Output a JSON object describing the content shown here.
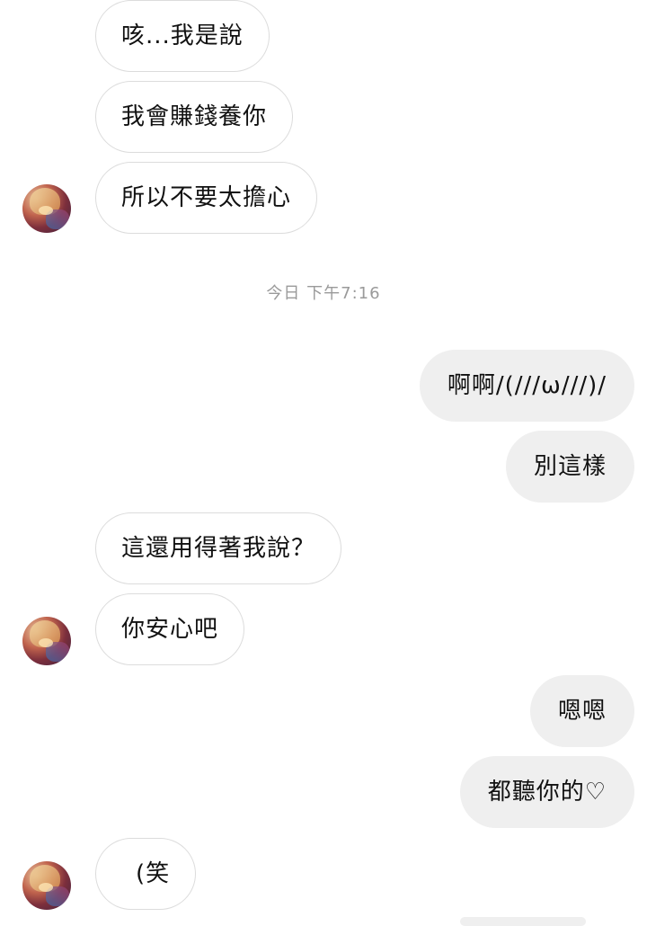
{
  "conversation": {
    "timestamp": "今日 下午7:16",
    "messages": [
      {
        "sender": "them",
        "text": "咳...我是說"
      },
      {
        "sender": "them",
        "text": "我會賺錢養你"
      },
      {
        "sender": "them",
        "text": "所以不要太擔心"
      },
      {
        "sender": "me",
        "text": "啊啊/(///ω///)/"
      },
      {
        "sender": "me",
        "text": "別這樣"
      },
      {
        "sender": "them",
        "text": "這還用得著我說？"
      },
      {
        "sender": "them",
        "text": "你安心吧"
      },
      {
        "sender": "me",
        "text": "嗯嗯"
      },
      {
        "sender": "me",
        "text": "都聽你的♡"
      },
      {
        "sender": "them",
        "text": "(笑"
      }
    ]
  },
  "colors": {
    "incoming_bubble_bg": "#ffffff",
    "incoming_bubble_border": "#dcdcdc",
    "outgoing_bubble_bg": "#efefef",
    "timestamp_text": "#9a9a9a"
  },
  "icons": {
    "avatar": "avatar"
  }
}
